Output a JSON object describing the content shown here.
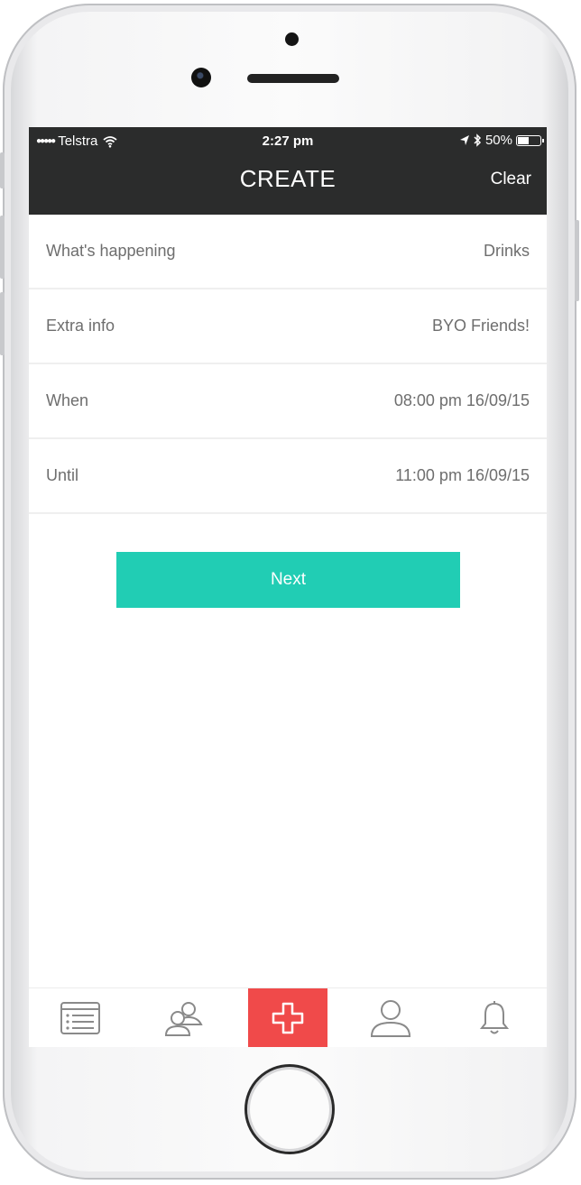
{
  "status_bar": {
    "signal_icon": "signal-dots",
    "carrier": "Telstra",
    "time": "2:27 pm",
    "battery": "50%",
    "battery_level": 0.5
  },
  "nav": {
    "title": "CREATE",
    "clear_label": "Clear"
  },
  "form": {
    "rows": [
      {
        "label": "What's happening",
        "value": "Drinks"
      },
      {
        "label": "Extra info",
        "value": "BYO Friends!"
      },
      {
        "label": "When",
        "value": "08:00 pm 16/09/15"
      },
      {
        "label": "Until",
        "value": "11:00 pm 16/09/15"
      }
    ]
  },
  "next_label": "Next",
  "tabs": [
    {
      "icon": "calendar-list-icon",
      "active": false
    },
    {
      "icon": "friends-icon",
      "active": false
    },
    {
      "icon": "plus-icon",
      "active": true
    },
    {
      "icon": "profile-icon",
      "active": false
    },
    {
      "icon": "bell-icon",
      "active": false
    }
  ],
  "colors": {
    "bar_dark": "#2b2c2c",
    "accent_teal": "#21cdb4",
    "active_tab_red": "#f04a4a",
    "text_grey": "#6e6e6e"
  }
}
